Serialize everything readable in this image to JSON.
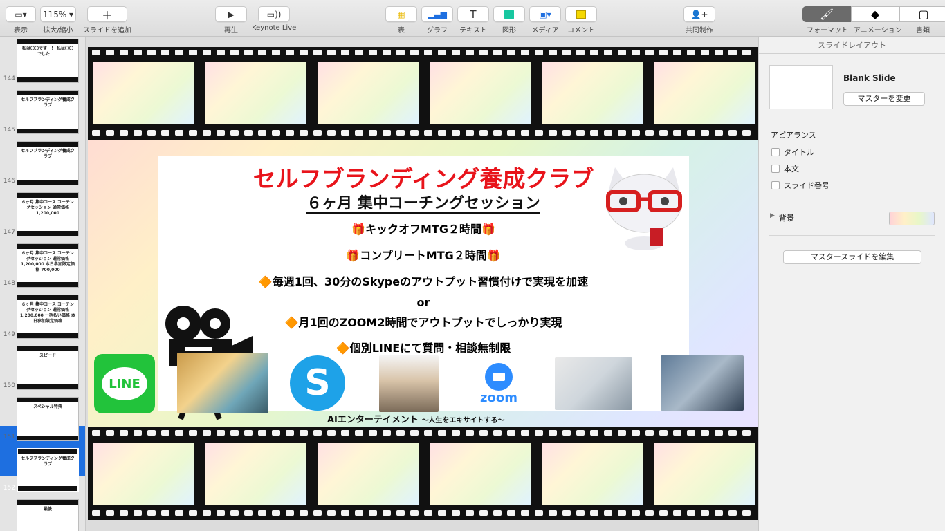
{
  "toolbar": {
    "view_label": "表示",
    "zoom_value": "115%",
    "zoom_label": "拡大/縮小",
    "add_slide_label": "スライドを追加",
    "play_label": "再生",
    "keynote_live_label": "Keynote Live",
    "table_label": "表",
    "chart_label": "グラフ",
    "text_label": "テキスト",
    "shape_label": "図形",
    "media_label": "メディア",
    "comment_label": "コメント",
    "collaborate_label": "共同制作",
    "format_label": "フォーマット",
    "animate_label": "アニメーション",
    "document_label": "書類"
  },
  "navigator": {
    "slides": [
      {
        "num": "144",
        "text": "私は〇〇です！！ 私は〇〇でした！！"
      },
      {
        "num": "145",
        "text": "セルフブランディング養成クラブ"
      },
      {
        "num": "146",
        "text": "セルフブランディング養成クラブ"
      },
      {
        "num": "147",
        "text": "６ヶ月 集中コース コーチングセッション 通常価格 1,200,000"
      },
      {
        "num": "148",
        "text": "６ヶ月 集中コース コーチングセッション 通常価格 1,200,000 本日参加限定価格 700,000"
      },
      {
        "num": "149",
        "text": "６ヶ月 集中コース コーチングセッション 通常価格 1,200,000 一括払い価格 本日参加限定価格"
      },
      {
        "num": "150",
        "text": "スピード"
      },
      {
        "num": "151",
        "text": "スペシャル特典"
      },
      {
        "num": "152",
        "text": "セルフブランディング養成クラブ"
      },
      {
        "num": "153",
        "text": "最後"
      }
    ],
    "selected": "152"
  },
  "slide": {
    "title": "セルフブランディング養成クラブ",
    "subtitle": "６ヶ月 集中コーチングセッション",
    "line1": "🎁キックオフMTG２時間🎁",
    "line2": "🎁コンプリートMTG２時間🎁",
    "line3": "🔶毎週1回、30分のSkypeのアウトプット習慣付けで実現を加速",
    "line4": "or",
    "line5": "🔶月1回のZOOM2時間でアウトプットでしっかり実現",
    "line6": "🔶個別LINEにて質問・相談無制限",
    "caption_main": "AIエンターテイメント",
    "caption_sub": "〜人生をエキサイトする〜",
    "logo_line": "LINE",
    "logo_skype": "S",
    "logo_zoom": "zoom"
  },
  "inspector": {
    "header": "スライドレイアウト",
    "layout_name": "Blank Slide",
    "change_master": "マスターを変更",
    "appearance": "アピアランス",
    "opt_title": "タイトル",
    "opt_body": "本文",
    "opt_slide_number": "スライド番号",
    "background": "背景",
    "edit_master": "マスタースライドを編集"
  },
  "colors": {
    "accent": "#1e6fe0",
    "title_red": "#e8141b",
    "line_green": "#22c33b",
    "skype_blue": "#1ea2e8",
    "zoom_blue": "#2d8cff"
  }
}
